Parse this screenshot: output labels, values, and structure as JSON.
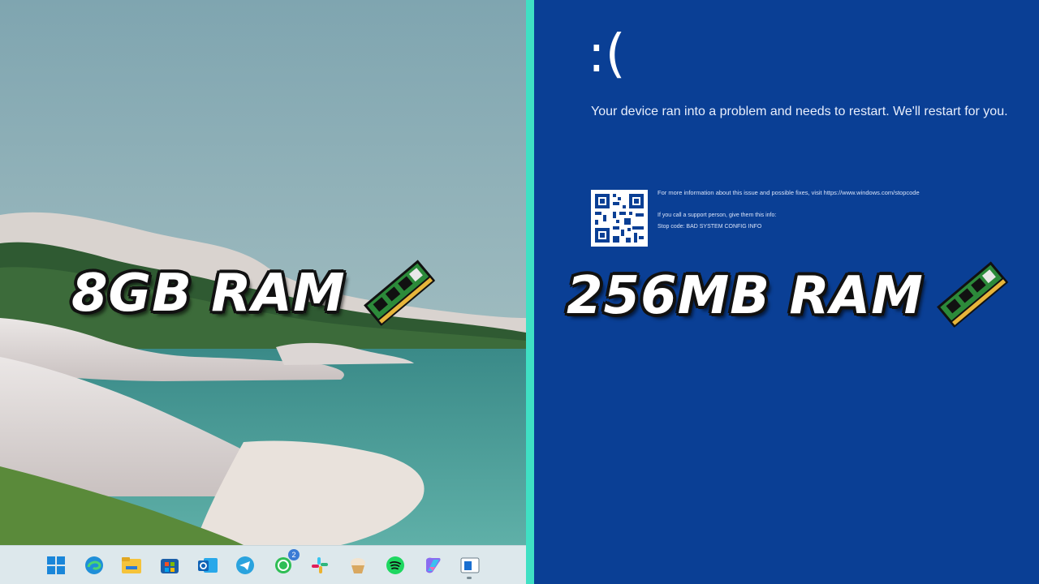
{
  "left_panel": {
    "caption": "8GB RAM",
    "taskbar": {
      "icons": [
        "windows-start-icon",
        "edge-icon",
        "file-explorer-icon",
        "store-icon",
        "outlook-icon",
        "telegram-icon",
        "whatsapp-icon",
        "slack-icon",
        "cupcake-icon",
        "spotify-icon",
        "copilot-icon",
        "app-window-icon"
      ],
      "whatsapp_badge": "2"
    }
  },
  "right_panel": {
    "caption": "256MB RAM",
    "bsod": {
      "face": ":(",
      "message": "Your device ran into a problem and needs to restart. We'll restart for you.",
      "info": "For more information about this issue and possible fixes, visit https://www.windows.com/stopcode",
      "support": "If you call a support person, give them this info:",
      "stop_code": "Stop code: BAD SYSTEM CONFIG INFO"
    }
  },
  "colors": {
    "bsod_blue": "#0a3f95",
    "divider": "#3fe0c4",
    "taskbar": "#dde8ec"
  }
}
